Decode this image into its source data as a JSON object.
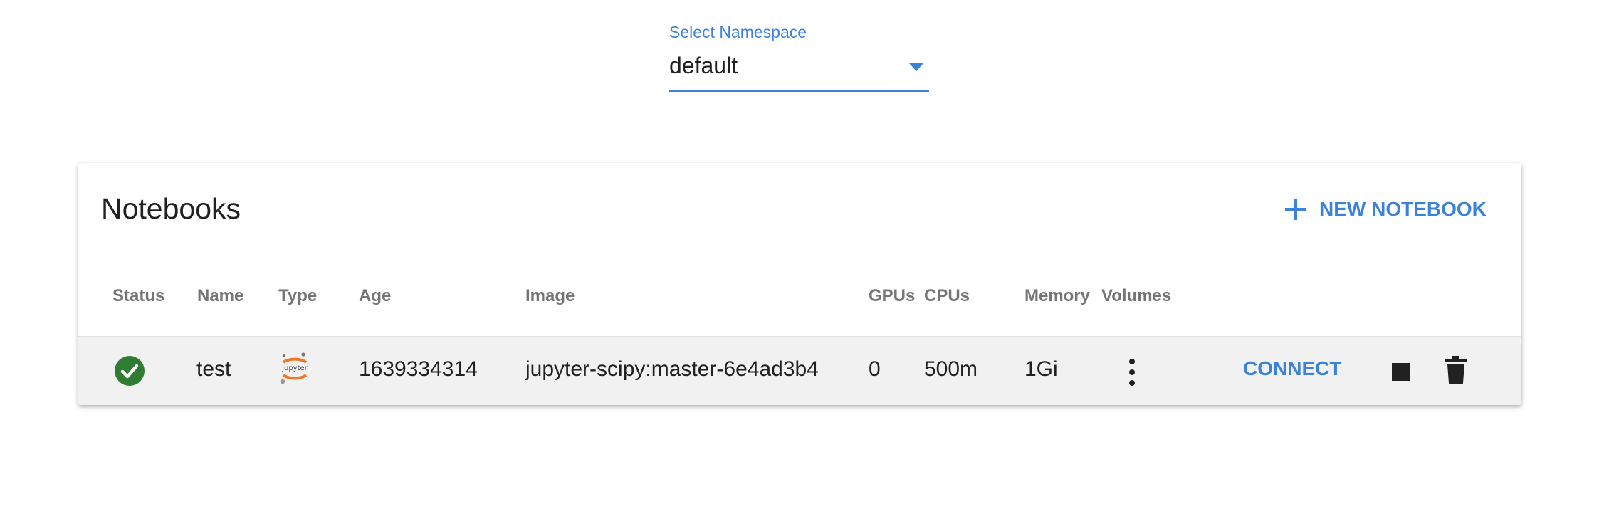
{
  "namespace": {
    "label": "Select Namespace",
    "value": "default",
    "accent_color": "#3b82d8"
  },
  "card": {
    "title": "Notebooks",
    "new_button_label": "NEW NOTEBOOK",
    "new_button_icon": "plus-icon"
  },
  "table": {
    "columns": [
      "Status",
      "Name",
      "Type",
      "Age",
      "Image",
      "GPUs",
      "CPUs",
      "Memory",
      "Volumes"
    ],
    "rows": [
      {
        "status_icon": "check-circle-icon",
        "status_color": "#2e7d32",
        "name": "test",
        "type_icon": "jupyter-icon",
        "age": "1639334314",
        "image": "jupyter-scipy:master-6e4ad3b4",
        "gpus": "0",
        "cpus": "500m",
        "memory": "1Gi",
        "volumes_icon": "more-vert-icon",
        "connect_label": "CONNECT",
        "stop_icon": "stop-icon",
        "delete_icon": "delete-icon"
      }
    ]
  }
}
